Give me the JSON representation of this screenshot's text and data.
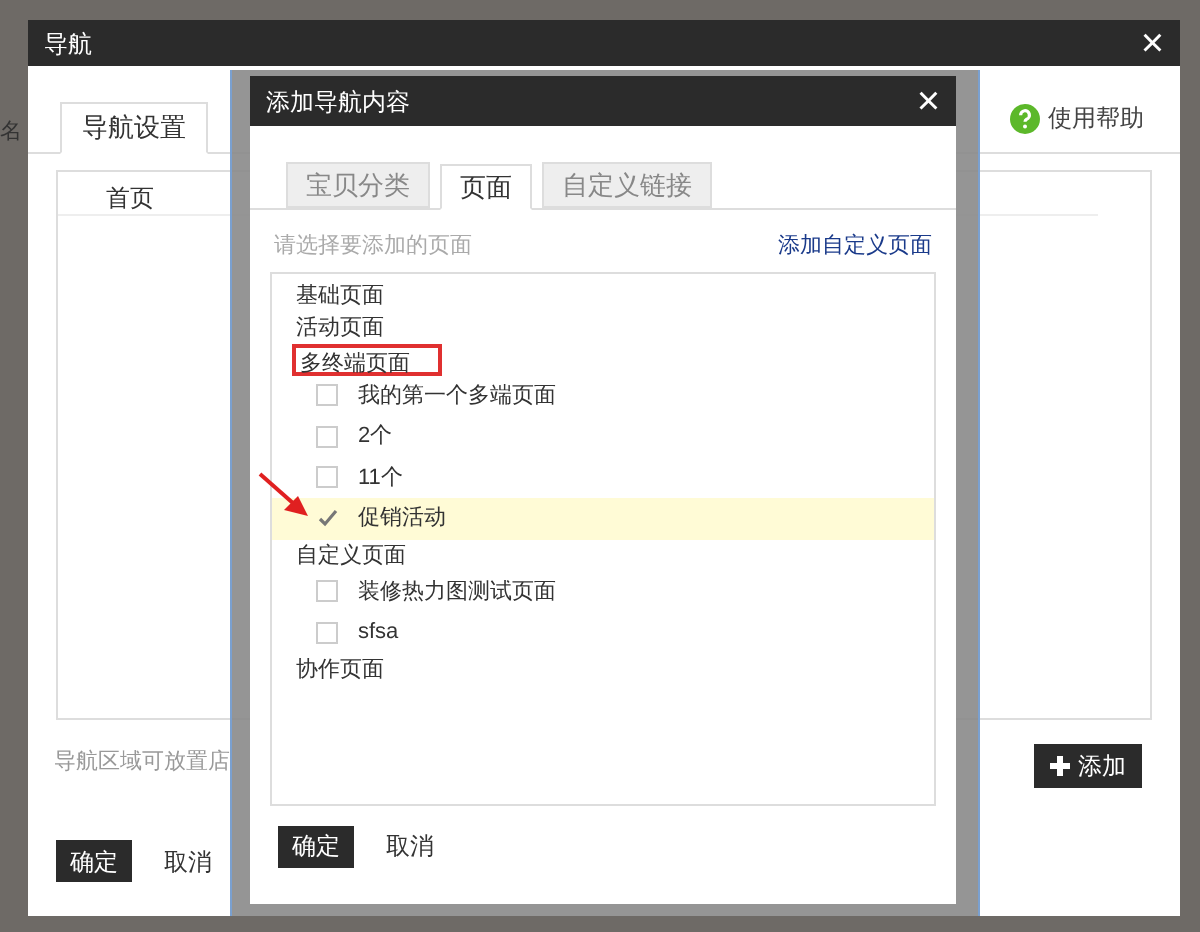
{
  "background": {
    "label": "名"
  },
  "window": {
    "title": "导航",
    "close": "×",
    "tabs": [
      {
        "label": "导航设置",
        "selected": true
      }
    ],
    "help": "使用帮助",
    "nav_items": [
      "首页"
    ],
    "hint": "导航区域可放置店",
    "add_button": "添加",
    "buttons": [
      {
        "label": "确定",
        "kind": "primary"
      },
      {
        "label": "取消",
        "kind": "plain"
      }
    ]
  },
  "dialog": {
    "title": "添加导航内容",
    "close": "×",
    "tabs": [
      {
        "label": "宝贝分类",
        "selected": false
      },
      {
        "label": "页面",
        "selected": true
      },
      {
        "label": "自定义链接",
        "selected": false
      }
    ],
    "prompt": "请选择要添加的页面",
    "link": "添加自定义页面",
    "groups": [
      {
        "label": "基础页面",
        "outlined": false
      },
      {
        "label": "活动页面",
        "outlined": false
      },
      {
        "label": "多终端页面",
        "outlined": true,
        "children": [
          {
            "label": "我的第一个多端页面",
            "checked": false,
            "selected": false
          },
          {
            "label": "2个",
            "checked": false,
            "selected": false
          },
          {
            "label": "11个",
            "checked": false,
            "selected": false
          },
          {
            "label": "促销活动",
            "checked": true,
            "selected": true
          }
        ]
      },
      {
        "label": "自定义页面",
        "outlined": false,
        "children": [
          {
            "label": "装修热力图测试页面",
            "checked": false,
            "selected": false
          },
          {
            "label": "sfsa",
            "checked": false,
            "selected": false
          }
        ]
      },
      {
        "label": "协作页面",
        "outlined": false
      }
    ],
    "buttons": [
      {
        "label": "确定",
        "kind": "primary"
      },
      {
        "label": "取消",
        "kind": "plain"
      }
    ]
  }
}
